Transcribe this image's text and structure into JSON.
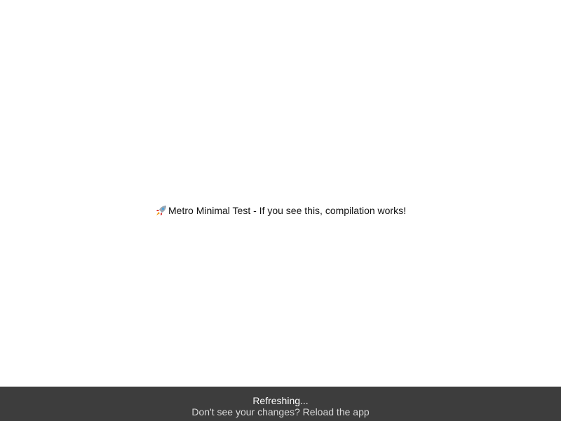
{
  "app": {
    "message_icon": "rocket-icon",
    "message": "Metro Minimal Test - If you see this, compilation works!"
  },
  "banner": {
    "title": "Refreshing...",
    "subtitle": "Don't see your changes? Reload the app",
    "background": "#3d3d3d"
  }
}
